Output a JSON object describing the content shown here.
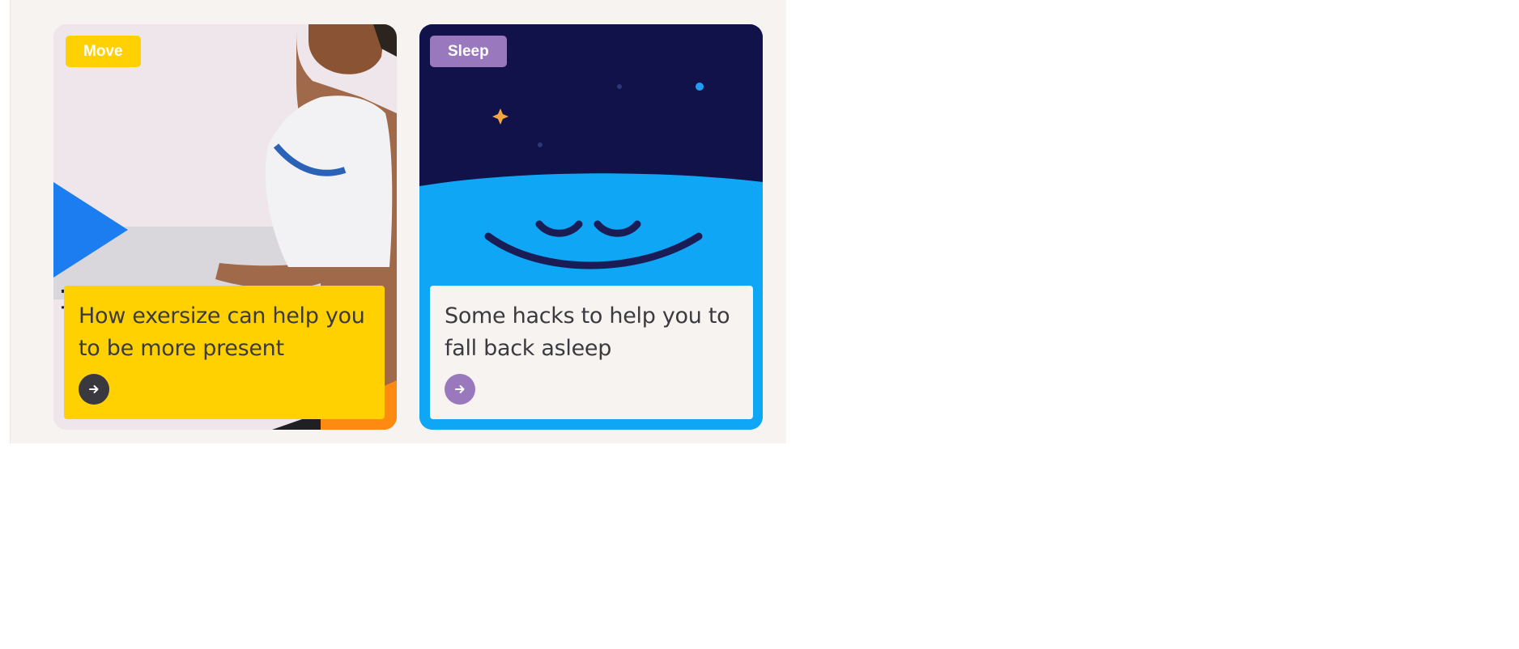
{
  "cards": [
    {
      "tag": "Move",
      "title": "How exersize can help you to be more present",
      "arrow_icon": "arrow-right-icon",
      "colors": {
        "tag": "#ffd100",
        "box": "#ffd100",
        "button": "#3a3940"
      }
    },
    {
      "tag": "Sleep",
      "title": "Some hacks to help you to fall back asleep",
      "arrow_icon": "arrow-right-icon",
      "colors": {
        "tag": "#9a78bd",
        "box": "#f6f3f0",
        "button": "#9a78bd"
      }
    }
  ]
}
